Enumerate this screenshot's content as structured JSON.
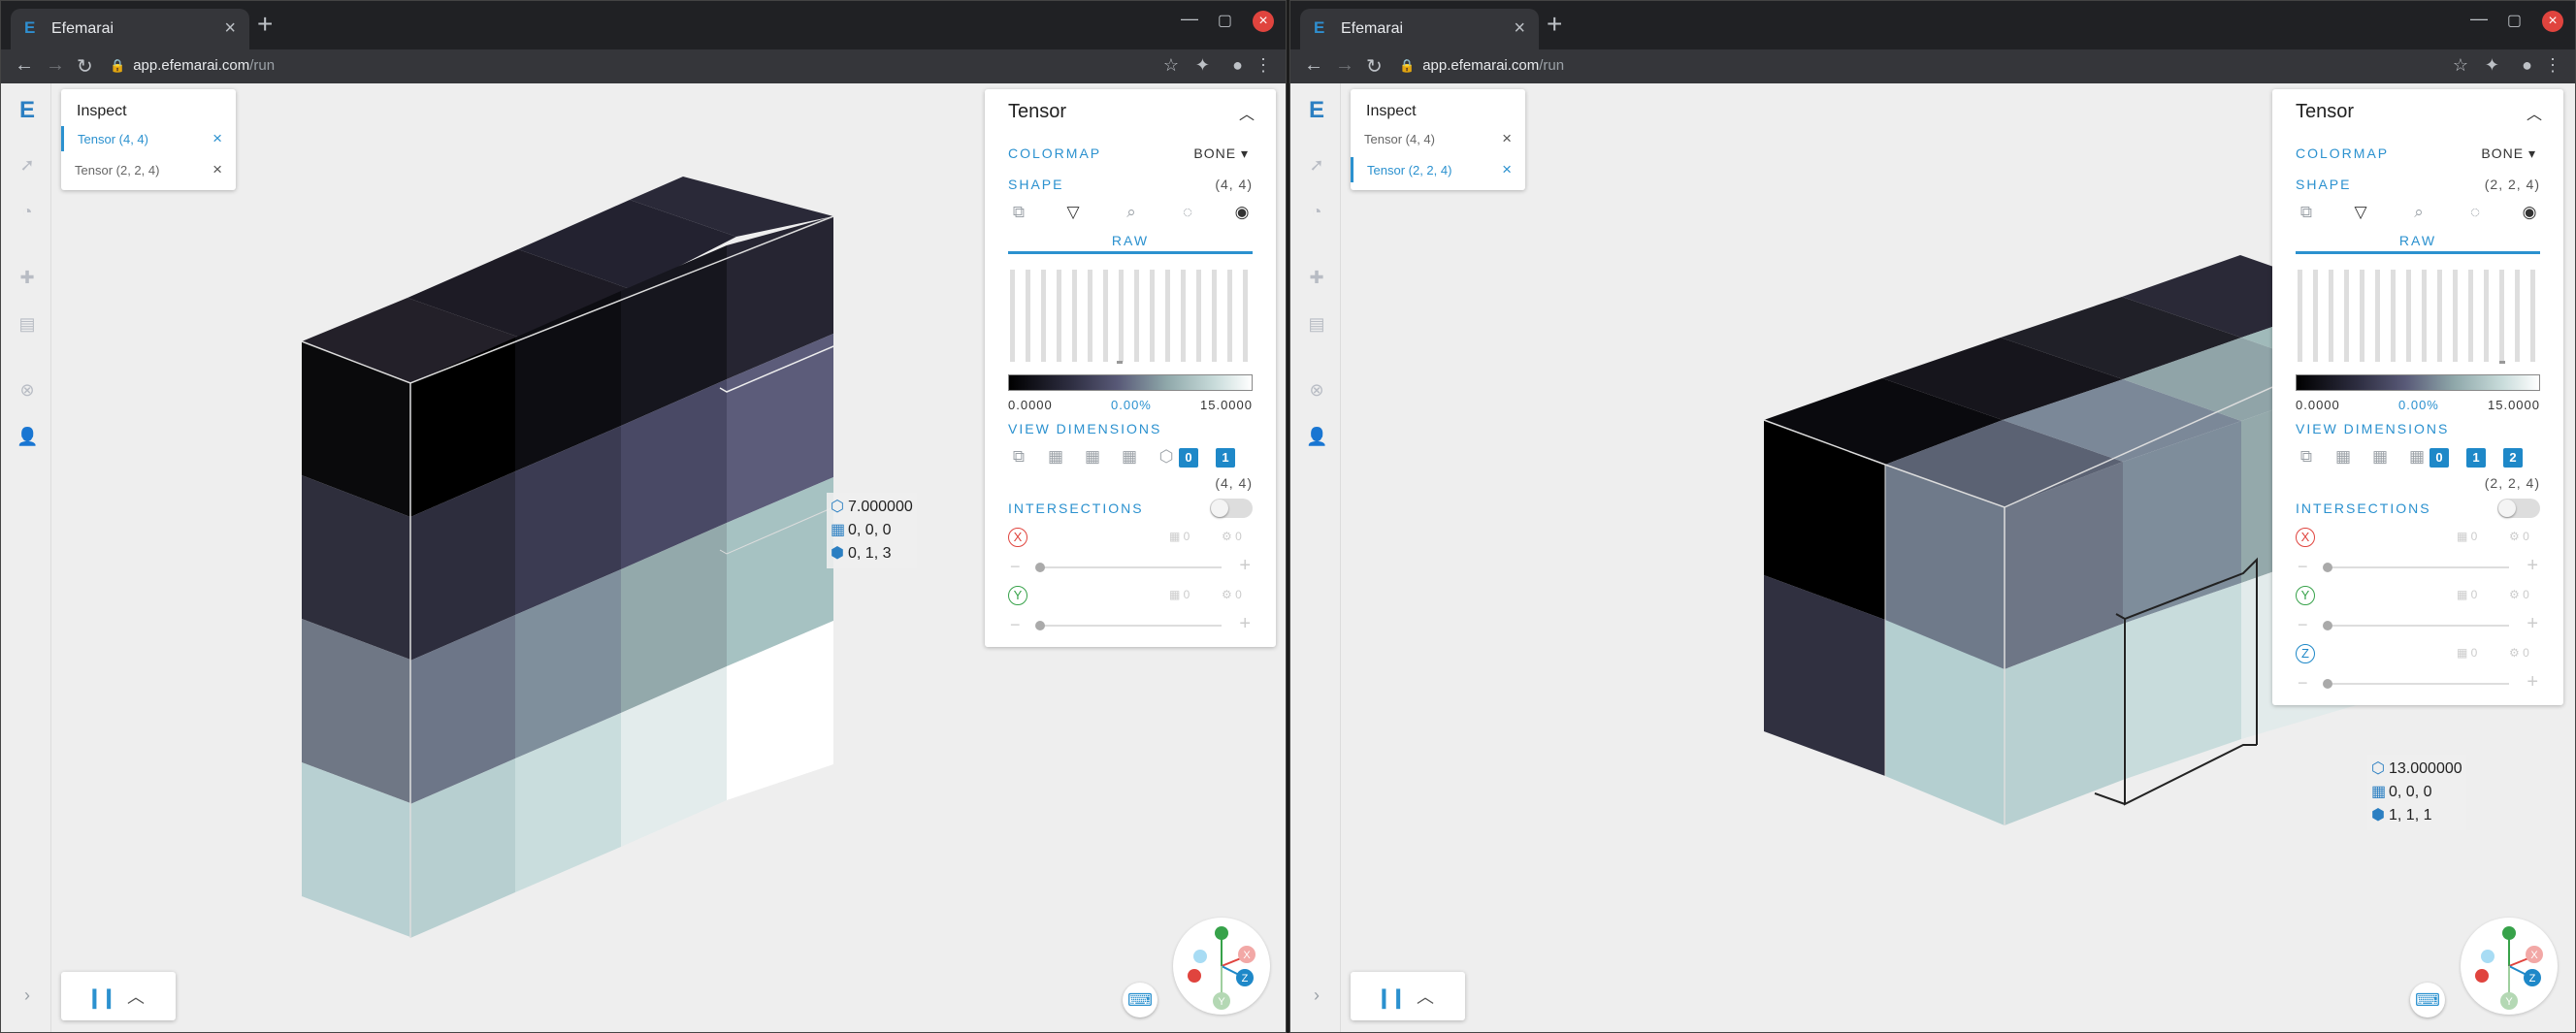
{
  "windows": [
    {
      "browser": {
        "tab_title": "Efemarai",
        "address_host": "app.efemarai.com",
        "address_path": "/run"
      },
      "inspect": {
        "title": "Inspect",
        "items": [
          {
            "label": "Tensor (4, 4)",
            "active": true
          },
          {
            "label": "Tensor (2, 2, 4)",
            "active": false
          }
        ]
      },
      "tooltip": {
        "value": "7.000000",
        "index": "0, 0, 0",
        "coord": "0, 1, 3"
      },
      "panel": {
        "title": "Tensor",
        "colormap_label": "COLORMAP",
        "colormap_value": "BONE",
        "shape_label": "SHAPE",
        "shape_value": "(4, 4)",
        "raw_tab": "RAW",
        "range_min": "0.0000",
        "range_mid": "0.00%",
        "range_max": "15.0000",
        "view_dims_label": "VIEW DIMENSIONS",
        "dim_chips": [
          "0",
          "1"
        ],
        "dims_value": "(4, 4)",
        "intersections_label": "INTERSECTIONS",
        "axes": [
          {
            "name": "X",
            "count_a": "0",
            "count_b": "0",
            "color": "#e0443e"
          },
          {
            "name": "Y",
            "count_a": "0",
            "count_b": "0",
            "color": "#37a24a"
          }
        ]
      }
    },
    {
      "browser": {
        "tab_title": "Efemarai",
        "address_host": "app.efemarai.com",
        "address_path": "/run"
      },
      "inspect": {
        "title": "Inspect",
        "items": [
          {
            "label": "Tensor (4, 4)",
            "active": false
          },
          {
            "label": "Tensor (2, 2, 4)",
            "active": true
          }
        ]
      },
      "tooltip": {
        "value": "13.000000",
        "index": "0, 0, 0",
        "coord": "1, 1, 1"
      },
      "panel": {
        "title": "Tensor",
        "colormap_label": "COLORMAP",
        "colormap_value": "BONE",
        "shape_label": "SHAPE",
        "shape_value": "(2, 2, 4)",
        "raw_tab": "RAW",
        "range_min": "0.0000",
        "range_mid": "0.00%",
        "range_max": "15.0000",
        "view_dims_label": "VIEW DIMENSIONS",
        "dim_chips": [
          "0",
          "1",
          "2"
        ],
        "dims_value": "(2, 2, 4)",
        "intersections_label": "INTERSECTIONS",
        "axes": [
          {
            "name": "X",
            "count_a": "0",
            "count_b": "0",
            "color": "#e0443e"
          },
          {
            "name": "Y",
            "count_a": "0",
            "count_b": "0",
            "color": "#37a24a"
          },
          {
            "name": "Z",
            "count_a": "0",
            "count_b": "0",
            "color": "#1e88c8"
          }
        ]
      }
    }
  ],
  "gizmo": {
    "x_label": "X",
    "y_label": "Y",
    "z_label": "Z"
  },
  "colors": {
    "accent": "#2b91cf",
    "brand": "#2b7fc2"
  },
  "icons": {
    "rail": [
      "efemarai-logo-icon",
      "rocket-icon",
      "dashboard-icon",
      "puzzle-icon",
      "dataset-icon",
      "support-icon",
      "user-icon"
    ],
    "panel_toolbar": [
      "copy-icon",
      "filter-icon",
      "search-icon",
      "hide-icon",
      "eye-icon"
    ]
  }
}
